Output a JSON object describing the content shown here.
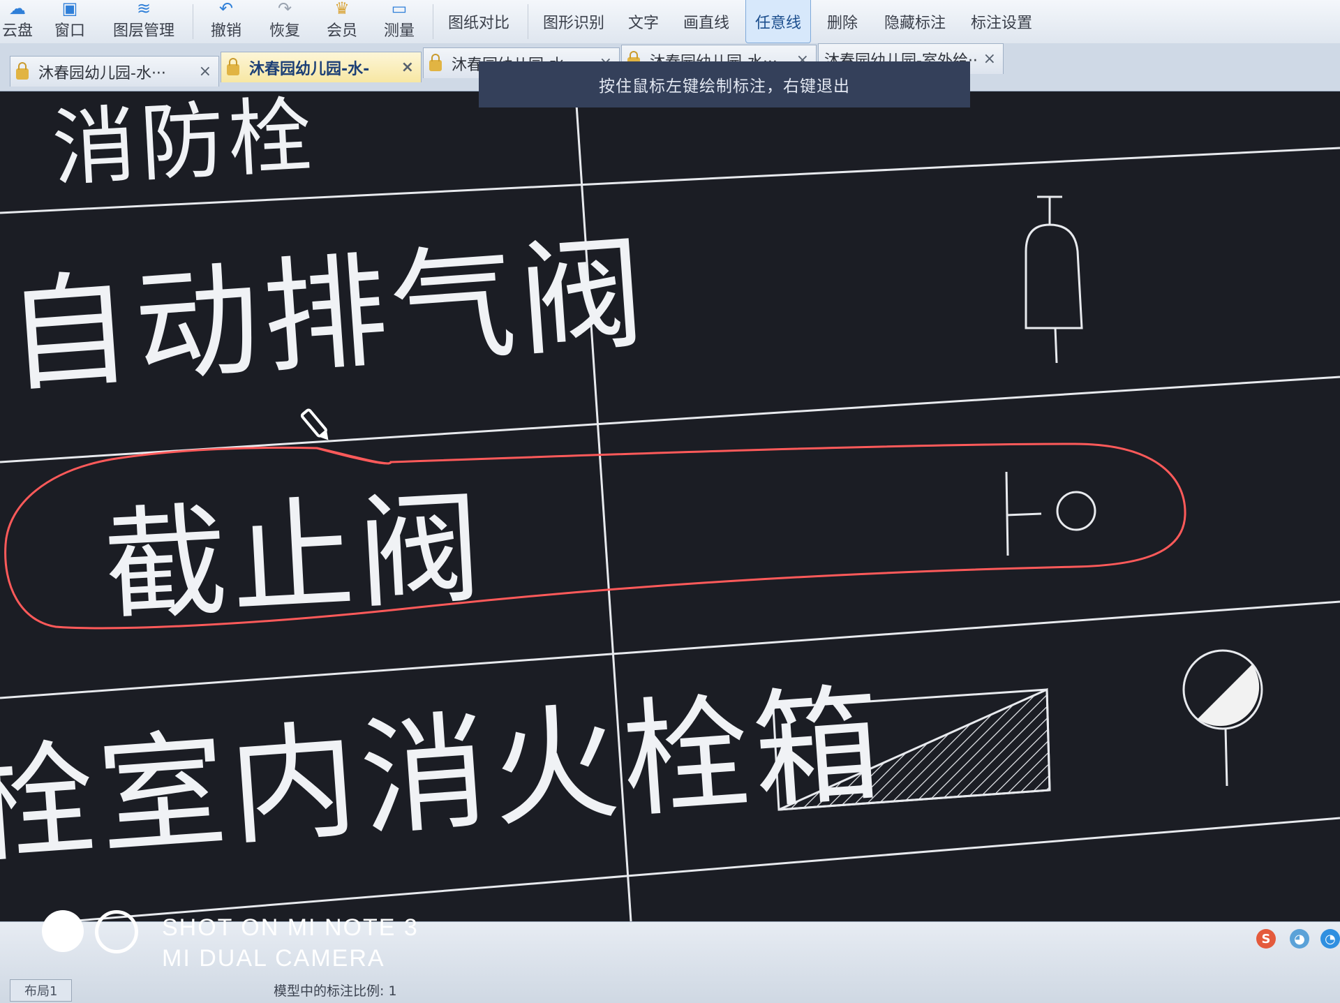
{
  "toolbar": {
    "items": [
      {
        "label": "云盘"
      },
      {
        "label": "窗口"
      },
      {
        "label": "图层管理"
      },
      {
        "label": "撤销"
      },
      {
        "label": "恢复"
      },
      {
        "label": "会员"
      },
      {
        "label": "测量"
      },
      {
        "label": "图纸对比"
      },
      {
        "label": "图形识别"
      },
      {
        "label": "文字"
      },
      {
        "label": "画直线"
      },
      {
        "label": "任意线"
      },
      {
        "label": "删除"
      },
      {
        "label": "隐藏标注"
      },
      {
        "label": "标注设置"
      }
    ]
  },
  "tabs": [
    {
      "label": "沐春园幼儿园-水···",
      "close": "×"
    },
    {
      "label": "沐春园幼儿园-水-",
      "close": "×"
    },
    {
      "label": "沐春园幼儿园-水···",
      "close": "×"
    },
    {
      "label": "沐春园幼儿园-水···",
      "close": "×"
    },
    {
      "label": "沐春园幼儿园-室外给···",
      "close": "×"
    }
  ],
  "hint": "按住鼠标左键绘制标注，右键退出",
  "legend": {
    "rows": [
      {
        "name": "消防栓"
      },
      {
        "name": "自动排气阀"
      },
      {
        "name": "截止阀"
      },
      {
        "name": "栓室内消火栓箱"
      }
    ]
  },
  "annotation": {
    "color": "#ff5a5a"
  },
  "status": {
    "layout_tab": "布局1",
    "scale_label": "模型中的标注比例: 1"
  },
  "watermark": {
    "line1": "SHOT ON MI NOTE 3",
    "line2": "MI DUAL CAMERA"
  }
}
